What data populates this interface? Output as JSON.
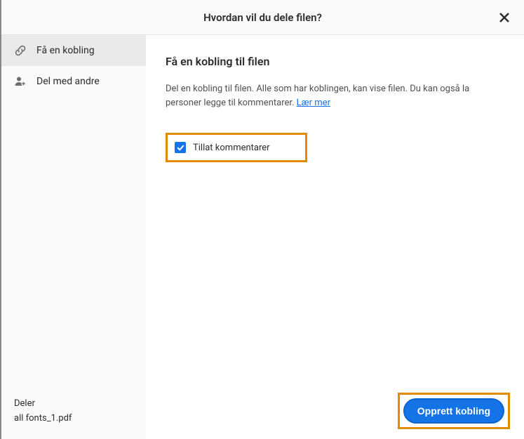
{
  "header": {
    "title": "Hvordan vil du dele filen?"
  },
  "sidebar": {
    "items": [
      {
        "label": "Få en kobling"
      },
      {
        "label": "Del med andre"
      }
    ],
    "footer": {
      "line1": "Deler",
      "line2": "all fonts_1.pdf"
    }
  },
  "main": {
    "heading": "Få en kobling til filen",
    "description": "Del en kobling til filen. Alle som har koblingen, kan vise filen. Du kan også la personer legge til kommentarer. ",
    "learn_more": "Lær mer",
    "checkbox_label": "Tillat kommentarer",
    "primary_button": "Opprett kobling"
  },
  "colors": {
    "accent": "#1473e6",
    "highlight_border": "#e38b00"
  }
}
